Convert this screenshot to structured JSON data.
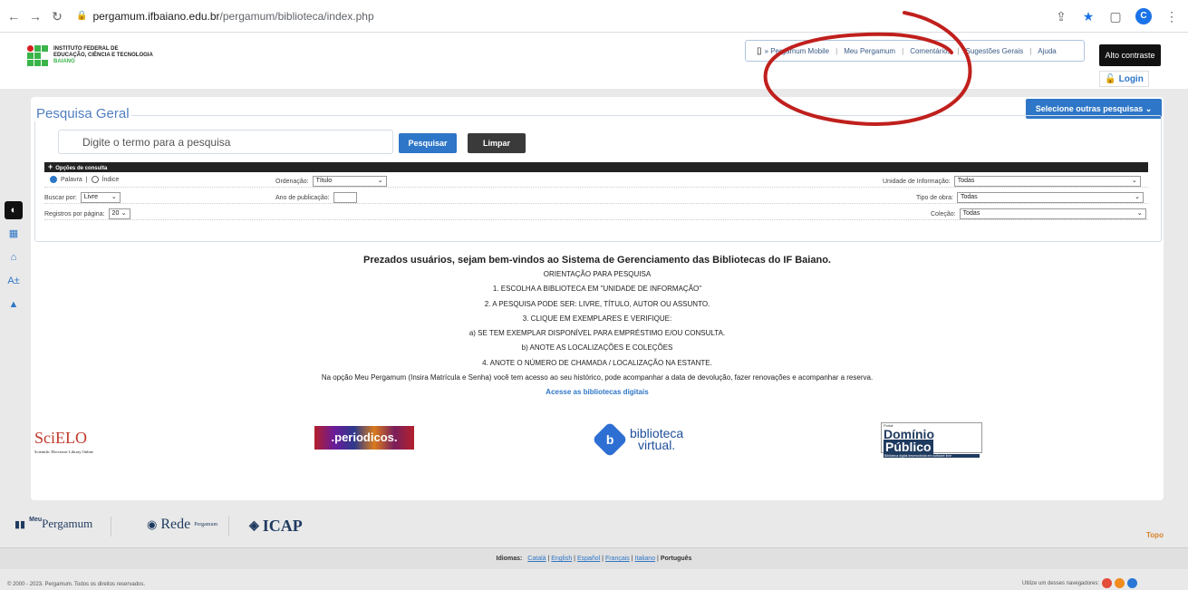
{
  "browser": {
    "url_host": "pergamum.ifbaiano.edu.br",
    "url_path": "/pergamum/biblioteca/index.php",
    "profile_initial": "C"
  },
  "header": {
    "logo_line1": "INSTITUTO FEDERAL DE",
    "logo_line2": "EDUCAÇÃO, CIÊNCIA E TECNOLOGIA",
    "logo_line3": "BAIANO",
    "menu": [
      "» Pergamum Mobile",
      "Meu Pergamum",
      "Comentários",
      "Sugestões Gerais",
      "Ajuda"
    ],
    "contrast_label": "Alto contraste",
    "login_label": "Login"
  },
  "search": {
    "title": "Pesquisa Geral",
    "select_other_label": "Selecione outras pesquisas",
    "placeholder": "Digite o termo para a pesquisa",
    "search_btn": "Pesquisar",
    "clear_btn": "Limpar",
    "options_title": "Opções de consulta",
    "radio_palavra": "Palavra",
    "radio_indice": "Índice",
    "buscar_por_label": "Buscar por:",
    "buscar_por_value": "Livre",
    "registros_label": "Registros por página:",
    "registros_value": "20",
    "ordenacao_label": "Ordenação:",
    "ordenacao_value": "Título",
    "ano_label": "Ano de publicação:",
    "unidade_label": "Unidade de Informação:",
    "unidade_value": "Todas",
    "tipo_label": "Tipo de obra:",
    "tipo_value": "Todas",
    "colecao_label": "Coleção:",
    "colecao_value": "Todas"
  },
  "welcome": {
    "heading": "Prezados usuários, sejam bem-vindos ao Sistema de Gerenciamento das Bibliotecas do IF Baiano.",
    "lines": [
      "ORIENTAÇÃO PARA PESQUISA",
      "1. ESCOLHA A BIBLIOTECA EM \"UNIDADE DE INFORMAÇÃO\"",
      "2. A PESQUISA PODE SER: LIVRE, TÍTULO, AUTOR OU ASSUNTO.",
      "3. CLIQUE EM EXEMPLARES E VERIFIQUE:",
      "a) SE TEM EXEMPLAR DISPONÍVEL PARA EMPRÉSTIMO E/OU CONSULTA.",
      "b) ANOTE AS LOCALIZAÇÕES E COLEÇÕES",
      "4. ANOTE O NÚMERO DE CHAMADA / LOCALIZAÇÃO NA ESTANTE.",
      "Na opção Meu Pergamum (Insira Matrícula e Senha) você tem acesso ao seu histórico, pode acompanhar a data de devolução, fazer renovações e acompanhar a reserva."
    ],
    "digital_link": "Acesse as bibliotecas digitais"
  },
  "partners": {
    "scielo_name": "SciELO",
    "scielo_sub": "Scientific Electronic Library Online",
    "periodicos": ".periodicos.",
    "bv_line1": "biblioteca",
    "bv_line2": "virtual.",
    "dp_top": "Portal",
    "dp_name1": "Domínio",
    "dp_name2": "Público",
    "dp_sub": "Biblioteca digital desenvolvida em software livre"
  },
  "footer": {
    "meu": "Meu",
    "pergamum": "Pergamum",
    "rede": "Rede",
    "rede_sub": "Pergamum",
    "icap": "ICAP",
    "topo": "Topo",
    "idiomas_label": "Idiomas:",
    "languages": [
      "Català",
      "English",
      "Español",
      "Français",
      "Italiano"
    ],
    "current_language": "Português",
    "copyright": "© 2000 - 2023. Pergamum. Todos os direitos reservados.",
    "browsers_label": "Utilize um desses navegadores:"
  },
  "colors": {
    "accent": "#2e76c7",
    "annotation": "#c0201d",
    "topo": "#d9822b"
  }
}
